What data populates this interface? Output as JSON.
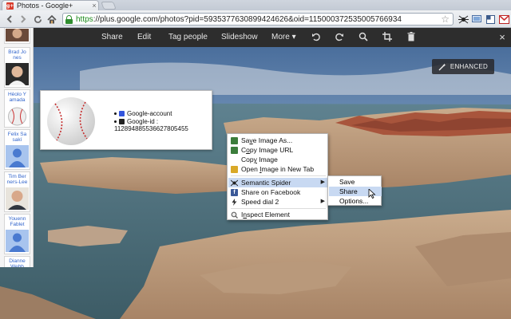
{
  "browser": {
    "tab_title": "Photos - Google+",
    "tab_favicon": "g+",
    "tab_close": "×",
    "url_scheme": "https",
    "url_rest": "://plus.google.com/photos?pid=5935377630899424626&oid=115000372535005766934",
    "star_icon": "☆"
  },
  "photo_toolbar": {
    "share": "Share",
    "edit": "Edit",
    "tag_people": "Tag people",
    "slideshow": "Slideshow",
    "more": "More",
    "more_chevron": "▾",
    "close": "×"
  },
  "enhanced_badge": "ENHANCED",
  "people": [
    {
      "name": "Brad Jo nes"
    },
    {
      "name": "Hèolo Y amada"
    },
    {
      "name": "Felix Sa sakí"
    },
    {
      "name": "Tim Ber ners-Lee"
    },
    {
      "name": "Youenn Fablet"
    },
    {
      "name": "Dianne Webb"
    }
  ],
  "hovercard": {
    "google_account": "Google-account",
    "google_id_label": "Google-id :",
    "google_id_value": "112894885536627805455"
  },
  "context_menu": {
    "items": [
      {
        "label": "Save Image As...",
        "underline": "v"
      },
      {
        "label": "Copy Image URL",
        "underline": "o"
      },
      {
        "label": "Copy Image",
        "underline": "y"
      },
      {
        "label": "Open Image in New Tab",
        "underline": "I"
      },
      {
        "label": "Semantic Spider"
      },
      {
        "label": "Share on Facebook"
      },
      {
        "label": "Speed dial 2"
      },
      {
        "label": "Inspect Element",
        "underline": "n"
      }
    ],
    "arrow": "▶"
  },
  "submenu": {
    "items": [
      {
        "label": "Save"
      },
      {
        "label": "Share"
      },
      {
        "label": "Options..."
      }
    ]
  }
}
